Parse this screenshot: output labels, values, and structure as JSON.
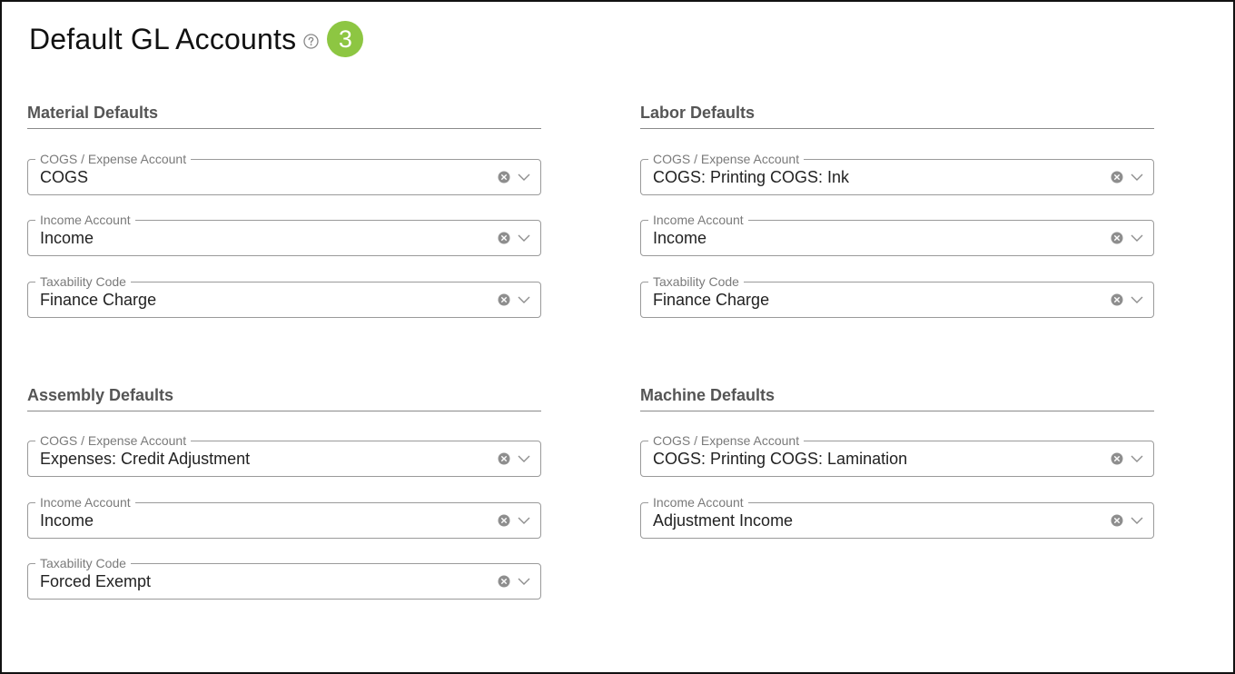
{
  "page": {
    "title": "Default GL Accounts",
    "step_number": "3",
    "help_icon": "question-circle-icon",
    "badge_color": "#8dc642"
  },
  "sections": {
    "material": {
      "title": "Material Defaults",
      "fields": [
        {
          "label": "COGS / Expense Account",
          "value": "COGS"
        },
        {
          "label": "Income Account",
          "value": "Income"
        },
        {
          "label": "Taxability Code",
          "value": "Finance Charge"
        }
      ]
    },
    "labor": {
      "title": "Labor Defaults",
      "fields": [
        {
          "label": "COGS / Expense Account",
          "value": "COGS: Printing COGS: Ink"
        },
        {
          "label": "Income Account",
          "value": "Income"
        },
        {
          "label": "Taxability Code",
          "value": "Finance Charge"
        }
      ]
    },
    "assembly": {
      "title": "Assembly Defaults",
      "fields": [
        {
          "label": "COGS / Expense Account",
          "value": "Expenses: Credit Adjustment"
        },
        {
          "label": "Income Account",
          "value": "Income"
        },
        {
          "label": "Taxability Code",
          "value": "Forced Exempt"
        }
      ]
    },
    "machine": {
      "title": "Machine Defaults",
      "fields": [
        {
          "label": "COGS / Expense Account",
          "value": "COGS: Printing COGS: Lamination"
        },
        {
          "label": "Income Account",
          "value": "Adjustment Income"
        }
      ]
    }
  },
  "icons": {
    "clear": "clear-circle-icon",
    "dropdown": "chevron-down-icon"
  }
}
